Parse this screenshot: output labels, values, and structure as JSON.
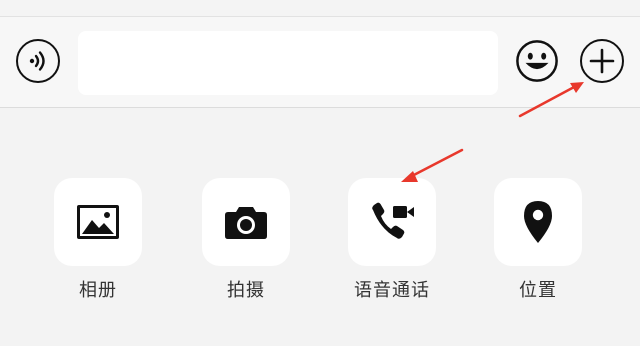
{
  "input_bar": {
    "voice_icon": "voice-wave-icon",
    "emoji_icon": "smiley-face-icon",
    "plus_icon": "plus-circle-icon",
    "message_value": ""
  },
  "tools": [
    {
      "label": "相册",
      "icon": "photo-album-icon"
    },
    {
      "label": "拍摄",
      "icon": "camera-icon"
    },
    {
      "label": "语音通话",
      "icon": "voice-video-call-icon"
    },
    {
      "label": "位置",
      "icon": "location-pin-icon"
    }
  ],
  "annotations": {
    "arrow_color": "#e8382c"
  },
  "colors": {
    "icon": "#111111",
    "tile": "#ffffff",
    "background": "#f3f3f3",
    "label": "#333333"
  }
}
